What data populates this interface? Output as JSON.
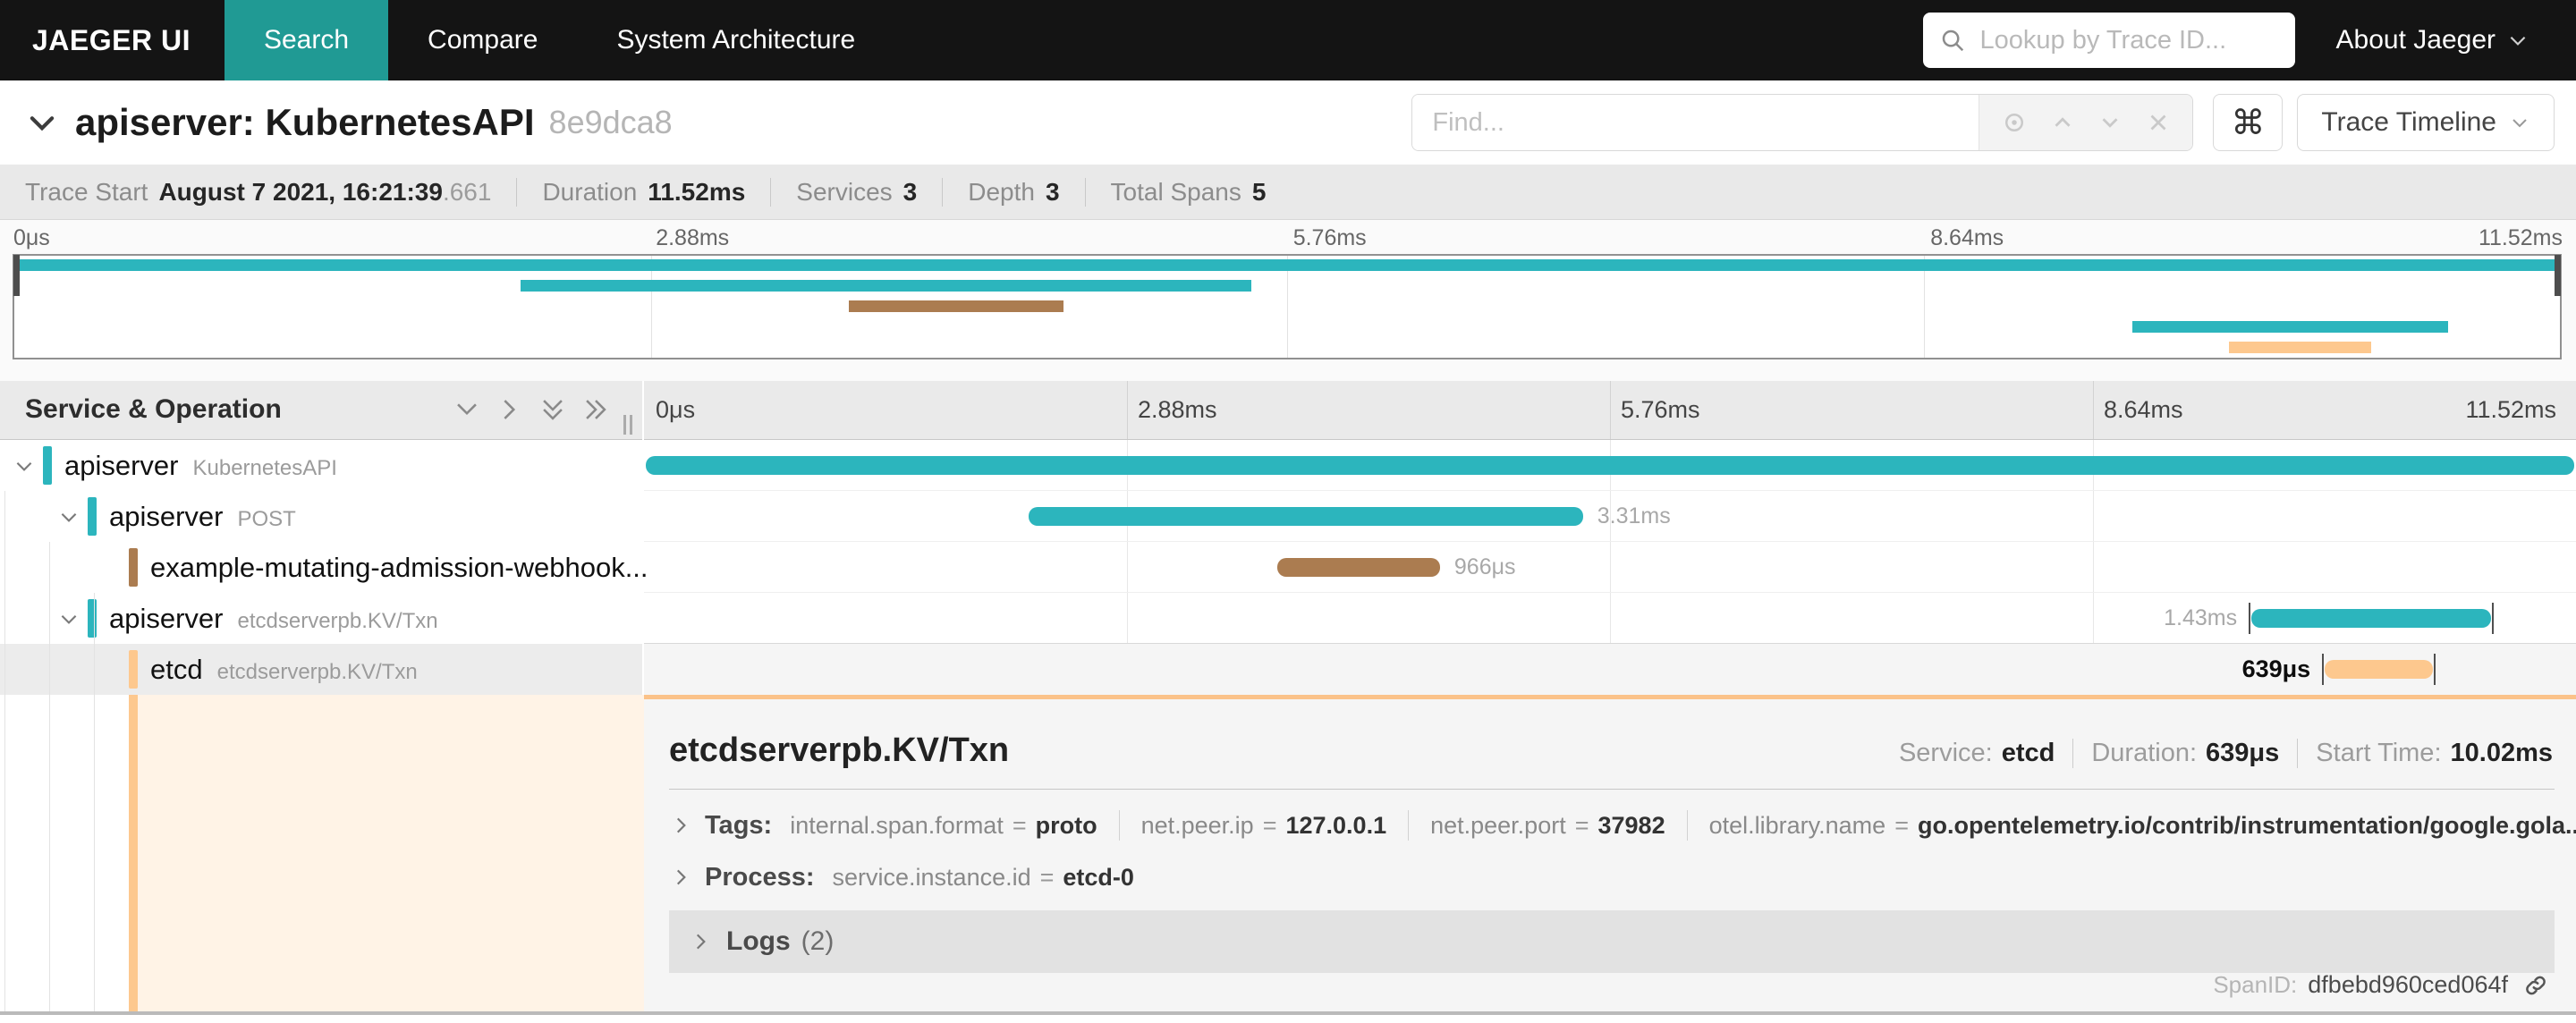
{
  "nav": {
    "brand": "JAEGER UI",
    "tabs": [
      {
        "label": "Search",
        "active": true
      },
      {
        "label": "Compare",
        "active": false
      },
      {
        "label": "System Architecture",
        "active": false
      }
    ],
    "lookup_placeholder": "Lookup by Trace ID...",
    "about_label": "About Jaeger"
  },
  "header": {
    "title": "apiserver: KubernetesAPI",
    "trace_id": "8e9dca8",
    "find_placeholder": "Find...",
    "view_button": "Trace Timeline"
  },
  "icons": {
    "cmd": "⌘"
  },
  "summary": {
    "items": [
      {
        "label": "Trace Start",
        "value": "August 7 2021, 16:21:39",
        "suffix": ".661"
      },
      {
        "label": "Duration",
        "value": "11.52ms",
        "suffix": ""
      },
      {
        "label": "Services",
        "value": "3",
        "suffix": ""
      },
      {
        "label": "Depth",
        "value": "3",
        "suffix": ""
      },
      {
        "label": "Total Spans",
        "value": "5",
        "suffix": ""
      }
    ]
  },
  "timeline": {
    "column_header": "Service & Operation",
    "ticks": [
      "0μs",
      "2.88ms",
      "5.76ms",
      "8.64ms",
      "11.52ms"
    ]
  },
  "colors": {
    "teal": "#2cb5bd",
    "brown": "#ab7c50",
    "peach": "#fdc88e",
    "accent": "#fbc289"
  },
  "spans": [
    {
      "service": "apiserver",
      "operation": "KubernetesAPI",
      "depth": 0,
      "color": "teal",
      "start_pct": 0.1,
      "width_pct": 99.8,
      "duration_label": "",
      "label_side": "right"
    },
    {
      "service": "apiserver",
      "operation": "POST",
      "depth": 1,
      "color": "teal",
      "start_pct": 19.9,
      "width_pct": 28.7,
      "duration_label": "3.31ms",
      "label_side": "right"
    },
    {
      "service": "example-mutating-admission-webhook...",
      "operation": "",
      "depth": 2,
      "color": "brown",
      "start_pct": 32.8,
      "width_pct": 8.4,
      "duration_label": "966μs",
      "label_side": "right"
    },
    {
      "service": "apiserver",
      "operation": "etcdserverpb.KV/Txn",
      "depth": 1,
      "color": "teal",
      "start_pct": 83.2,
      "width_pct": 12.4,
      "duration_label": "1.43ms",
      "label_side": "left"
    },
    {
      "service": "etcd",
      "operation": "etcdserverpb.KV/Txn",
      "depth": 2,
      "color": "peach",
      "start_pct": 87.0,
      "width_pct": 5.6,
      "duration_label": "639μs",
      "label_side": "left"
    }
  ],
  "detail": {
    "title": "etcdserverpb.KV/Txn",
    "meta": [
      {
        "label": "Service:",
        "value": "etcd"
      },
      {
        "label": "Duration:",
        "value": "639μs"
      },
      {
        "label": "Start Time:",
        "value": "10.02ms"
      }
    ],
    "tags_label": "Tags:",
    "tags": [
      {
        "k": "internal.span.format",
        "eq": "=",
        "v": "proto"
      },
      {
        "k": "net.peer.ip",
        "eq": "=",
        "v": "127.0.0.1"
      },
      {
        "k": "net.peer.port",
        "eq": "=",
        "v": "37982"
      },
      {
        "k": "otel.library.name",
        "eq": "=",
        "v": "go.opentelemetry.io/contrib/instrumentation/google.gola..."
      }
    ],
    "process_label": "Process:",
    "process": [
      {
        "k": "service.instance.id",
        "eq": "=",
        "v": "etcd-0"
      }
    ],
    "logs_label": "Logs",
    "logs_count": "(2)",
    "spanid_label": "SpanID:",
    "spanid": "dfbebd960ced064f"
  }
}
